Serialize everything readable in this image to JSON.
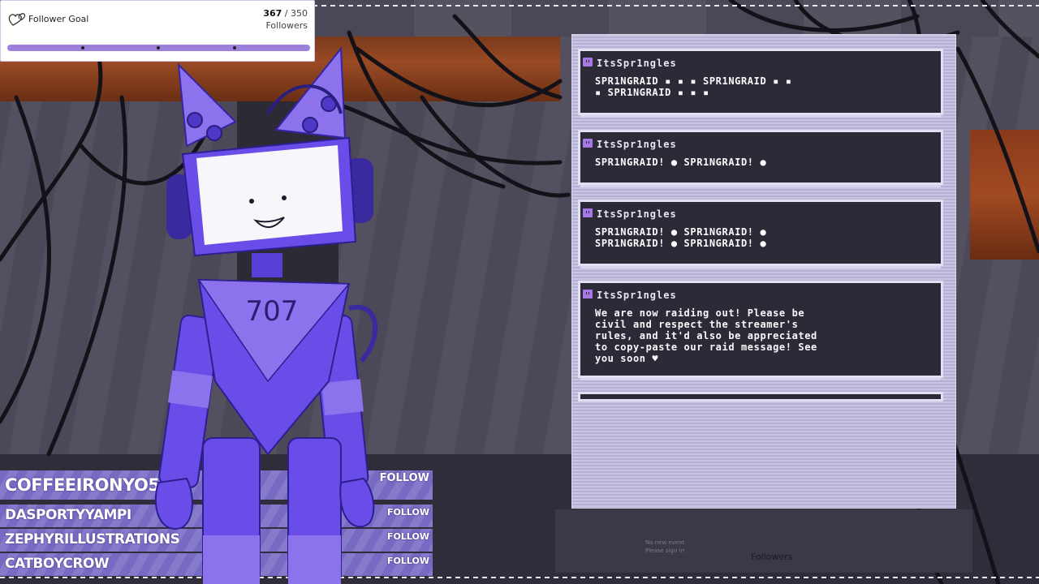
{
  "follower_goal": {
    "title": "Follower Goal",
    "current": "367",
    "separator": " / ",
    "target": "350",
    "unit": "Followers",
    "progress_fraction": 1.0
  },
  "character": {
    "chest_label": "707"
  },
  "chat": {
    "messages": [
      {
        "user": "ItsSpr1ngles",
        "text": "SPR1NGRAID ▪ ▪ ▪ SPR1NGRAID ▪ ▪\n▪ SPR1NGRAID ▪ ▪ ▪"
      },
      {
        "user": "ItsSpr1ngles",
        "text": "SPR1NGRAID! ● SPR1NGRAID! ●"
      },
      {
        "user": "ItsSpr1ngles",
        "text": "SPR1NGRAID! ● SPR1NGRAID! ●\nSPR1NGRAID! ● SPR1NGRAID! ●"
      },
      {
        "user": "ItsSpr1ngles",
        "text": "We are now raiding out! Please be\ncivil and respect the streamer's\nrules, and it'd also be appreciated\nto copy-paste our raid message! See\nyou soon ♥"
      }
    ]
  },
  "below_chat": {
    "small_text_line1": "No new event",
    "small_text_line2": "Please sign in",
    "label": "Followers"
  },
  "recent_followers": [
    {
      "name": "COFFEEIRONYO5",
      "action": "FOLLOW"
    },
    {
      "name": "DASPORTYYAMPI",
      "action": "FOLLOW"
    },
    {
      "name": "ZEPHYRILLUSTRATIONS",
      "action": "FOLLOW"
    },
    {
      "name": "CATBOYCROW",
      "action": "FOLLOW"
    }
  ],
  "colors": {
    "accent": "#8a7fd2",
    "character": "#6a4ce8",
    "chat_bg": "#2d2a38",
    "goal_bar": "#a98be0"
  }
}
